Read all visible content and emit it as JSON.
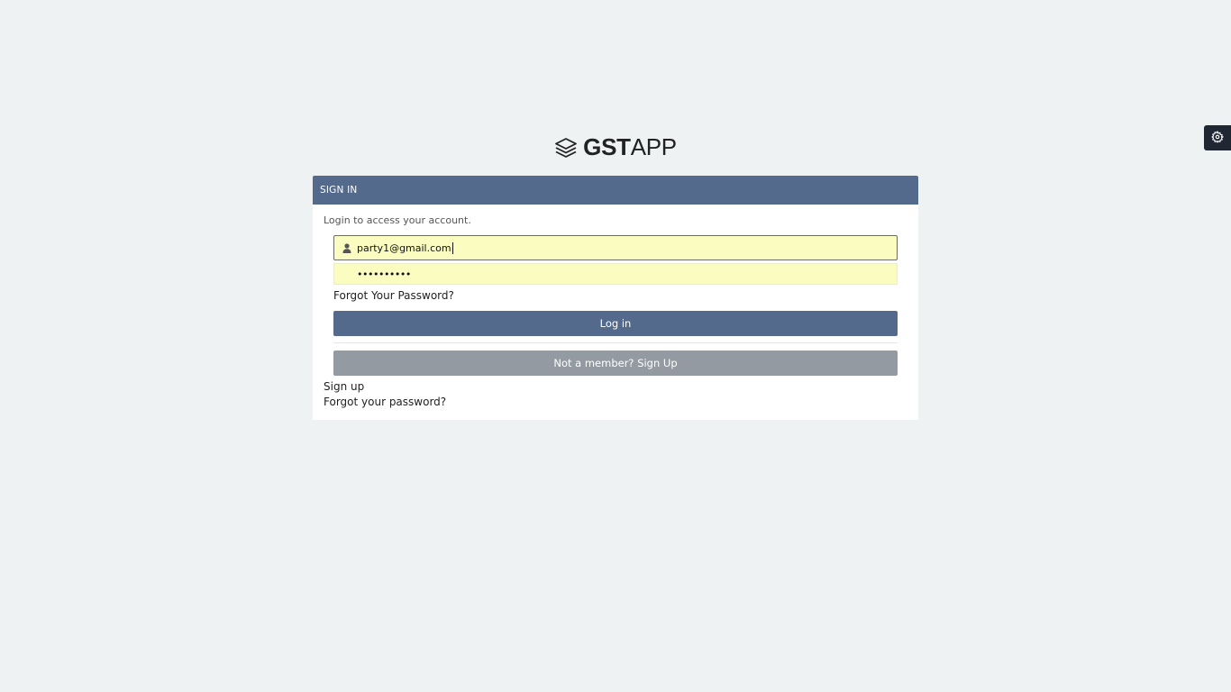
{
  "brand": {
    "name_bold": "GST",
    "name_light": "APP",
    "icon": "layers-icon"
  },
  "settings_tab": {
    "icon": "gear-icon"
  },
  "card": {
    "header_title": "SIGN IN",
    "intro_text": "Login to access your account.",
    "email_field": {
      "icon": "user-icon",
      "value": "party1@gmail.com"
    },
    "password_field": {
      "value": "••••••••••"
    },
    "forgot_password_label": "Forgot Your Password?",
    "login_button_label": "Log in",
    "signup_button_label": "Not a member? Sign Up",
    "signup_link_label": "Sign up",
    "forgot_password_link_label": "Forgot your password?"
  },
  "colors": {
    "background": "#eef2f3",
    "header_blue": "#546a8d",
    "autofill_yellow": "#fbfdc0",
    "secondary_gray": "#939aa1",
    "gear_tab_dark": "#1f2733"
  }
}
